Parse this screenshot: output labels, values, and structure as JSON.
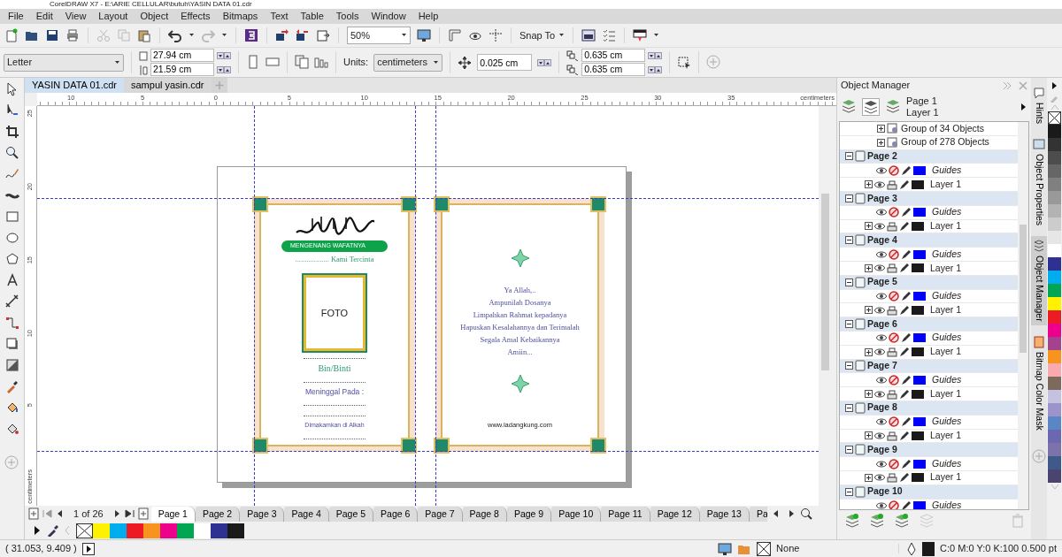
{
  "window": {
    "title": "CorelDRAW X7 - E:\\ARIE CELLULAR\\butuh\\YASIN DATA 01.cdr"
  },
  "menu": [
    "File",
    "Edit",
    "View",
    "Layout",
    "Object",
    "Effects",
    "Bitmaps",
    "Text",
    "Table",
    "Tools",
    "Window",
    "Help"
  ],
  "toolbar": {
    "zoom": "50%",
    "snap": "Snap To"
  },
  "property_bar": {
    "page_size": "Letter",
    "width": "27.94 cm",
    "height": "21.59 cm",
    "units_label": "Units:",
    "units": "centimeters",
    "nudge": "0.025 cm",
    "duplicate_x": "0.635 cm",
    "duplicate_y": "0.635 cm"
  },
  "document_tabs": [
    {
      "label": "YASIN DATA 01.cdr",
      "selected": true
    },
    {
      "label": "sampul yasin.cdr",
      "selected": false
    }
  ],
  "rulers": {
    "horizontal": [
      "10",
      "5",
      "0",
      "5",
      "10",
      "15",
      "20",
      "25",
      "30",
      "35"
    ],
    "horizontal_unit": "centimeters",
    "vertical": [
      "25",
      "20",
      "15",
      "10",
      "5"
    ],
    "vertical_unit": "centimeters"
  },
  "document": {
    "left_page": {
      "banner": "MENGENANG WAFATNYA",
      "subtitle": ".................. Kami Tercinta",
      "photo_label": "FOTO",
      "name_label": "Bin/Binti",
      "died_label": "Meninggal Pada :",
      "buried_label": "Dimakamkan di Alkah"
    },
    "right_page": {
      "prayer_lines": [
        "Ya Allah,..",
        "Ampunilah Dosanya",
        "Limpahkan Rahmat kepadanya",
        "Hapuskan Kesalahannya dan Terimalah",
        "Segala Amal Kebaikannya",
        "Amiin..."
      ],
      "website": "www.ladangkung.com"
    }
  },
  "page_navigator": {
    "position": "1 of 26",
    "pages": [
      {
        "label": "Page 1",
        "selected": true
      },
      {
        "label": "Page 2",
        "selected": false
      },
      {
        "label": "Page 3",
        "selected": false
      },
      {
        "label": "Page 4",
        "selected": false
      },
      {
        "label": "Page 5",
        "selected": false
      },
      {
        "label": "Page 6",
        "selected": false
      },
      {
        "label": "Page 7",
        "selected": false
      },
      {
        "label": "Page 8",
        "selected": false
      },
      {
        "label": "Page 9",
        "selected": false
      },
      {
        "label": "Page 10",
        "selected": false
      },
      {
        "label": "Page 11",
        "selected": false
      },
      {
        "label": "Page 12",
        "selected": false
      },
      {
        "label": "Page 13",
        "selected": false
      },
      {
        "label": "Pa",
        "selected": false
      }
    ]
  },
  "document_palette": [
    {
      "kind": "none"
    },
    {
      "kind": "color",
      "color": "#fff200"
    },
    {
      "kind": "color",
      "color": "#00aeef"
    },
    {
      "kind": "color",
      "color": "#ed1c24"
    },
    {
      "kind": "color",
      "color": "#f7941d"
    },
    {
      "kind": "color",
      "color": "#ec008c"
    },
    {
      "kind": "color",
      "color": "#00a651"
    },
    {
      "kind": "color",
      "color": "#ffffff"
    },
    {
      "kind": "color",
      "color": "#2e3192"
    },
    {
      "kind": "color",
      "color": "#1a1a1a"
    }
  ],
  "object_manager": {
    "title": "Object Manager",
    "current_page": "Page 1",
    "current_layer": "Layer 1",
    "tree": [
      {
        "kind": "group",
        "label": "Group of 34 Objects",
        "expanded": false
      },
      {
        "kind": "group",
        "label": "Group of 278 Objects",
        "expanded": false
      },
      {
        "kind": "page",
        "label": "Page 2",
        "expanded": true,
        "children": [
          {
            "kind": "guides",
            "label": "Guides",
            "color": "#0000ff"
          },
          {
            "kind": "layer",
            "label": "Layer 1",
            "color": "#1a1a1a",
            "expanded": false
          }
        ]
      },
      {
        "kind": "page",
        "label": "Page 3",
        "expanded": true,
        "children": [
          {
            "kind": "guides",
            "label": "Guides",
            "color": "#0000ff"
          },
          {
            "kind": "layer",
            "label": "Layer 1",
            "color": "#1a1a1a",
            "expanded": false
          }
        ]
      },
      {
        "kind": "page",
        "label": "Page 4",
        "expanded": true,
        "children": [
          {
            "kind": "guides",
            "label": "Guides",
            "color": "#0000ff"
          },
          {
            "kind": "layer",
            "label": "Layer 1",
            "color": "#1a1a1a",
            "expanded": false
          }
        ]
      },
      {
        "kind": "page",
        "label": "Page 5",
        "expanded": true,
        "children": [
          {
            "kind": "guides",
            "label": "Guides",
            "color": "#0000ff"
          },
          {
            "kind": "layer",
            "label": "Layer 1",
            "color": "#1a1a1a",
            "expanded": false
          }
        ]
      },
      {
        "kind": "page",
        "label": "Page 6",
        "expanded": true,
        "children": [
          {
            "kind": "guides",
            "label": "Guides",
            "color": "#0000ff"
          },
          {
            "kind": "layer",
            "label": "Layer 1",
            "color": "#1a1a1a",
            "expanded": false
          }
        ]
      },
      {
        "kind": "page",
        "label": "Page 7",
        "expanded": true,
        "children": [
          {
            "kind": "guides",
            "label": "Guides",
            "color": "#0000ff"
          },
          {
            "kind": "layer",
            "label": "Layer 1",
            "color": "#1a1a1a",
            "expanded": false
          }
        ]
      },
      {
        "kind": "page",
        "label": "Page 8",
        "expanded": true,
        "children": [
          {
            "kind": "guides",
            "label": "Guides",
            "color": "#0000ff"
          },
          {
            "kind": "layer",
            "label": "Layer 1",
            "color": "#1a1a1a",
            "expanded": false
          }
        ]
      },
      {
        "kind": "page",
        "label": "Page 9",
        "expanded": true,
        "children": [
          {
            "kind": "guides",
            "label": "Guides",
            "color": "#0000ff"
          },
          {
            "kind": "layer",
            "label": "Layer 1",
            "color": "#1a1a1a",
            "expanded": false
          }
        ]
      },
      {
        "kind": "page",
        "label": "Page 10",
        "expanded": true,
        "children": [
          {
            "kind": "guides",
            "label": "Guides",
            "color": "#0000ff"
          }
        ]
      }
    ]
  },
  "docker_tabs": [
    {
      "label": "Hints",
      "selected": false
    },
    {
      "label": "Object Properties",
      "selected": false
    },
    {
      "label": "Object Manager",
      "selected": true
    },
    {
      "label": "Bitmap Color Mask",
      "selected": false
    }
  ],
  "color_palette": [
    {
      "kind": "none"
    },
    {
      "kind": "color",
      "color": "#1a1a1a"
    },
    {
      "kind": "color",
      "color": "#333333"
    },
    {
      "kind": "color",
      "color": "#4d4d4d"
    },
    {
      "kind": "color",
      "color": "#666666"
    },
    {
      "kind": "color",
      "color": "#808080"
    },
    {
      "kind": "color",
      "color": "#999999"
    },
    {
      "kind": "color",
      "color": "#b3b3b3"
    },
    {
      "kind": "color",
      "color": "#cccccc"
    },
    {
      "kind": "color",
      "color": "#e6e6e6"
    },
    {
      "kind": "color",
      "color": "#ffffff"
    },
    {
      "kind": "color",
      "color": "#2e3192"
    },
    {
      "kind": "color",
      "color": "#00aeef"
    },
    {
      "kind": "color",
      "color": "#00a651"
    },
    {
      "kind": "color",
      "color": "#fff200"
    },
    {
      "kind": "color",
      "color": "#ed1c24"
    },
    {
      "kind": "color",
      "color": "#ec008c"
    },
    {
      "kind": "color",
      "color": "#a3428f"
    },
    {
      "kind": "color",
      "color": "#f7941d"
    },
    {
      "kind": "color",
      "color": "#f9a9b0"
    },
    {
      "kind": "color",
      "color": "#7d6a5d"
    },
    {
      "kind": "color",
      "color": "#c5c1e0"
    },
    {
      "kind": "color",
      "color": "#9b93c9"
    },
    {
      "kind": "color",
      "color": "#5b86c5"
    },
    {
      "kind": "color",
      "color": "#6b67b0"
    },
    {
      "kind": "color",
      "color": "#7b73a9"
    },
    {
      "kind": "color",
      "color": "#3d5a8a"
    },
    {
      "kind": "color",
      "color": "#4a4470"
    }
  ],
  "status_bar": {
    "coordinates": "( 31.053, 9.409 )",
    "fill": "None",
    "outline": "C:0 M:0 Y:0 K:100  0.500 pt"
  }
}
